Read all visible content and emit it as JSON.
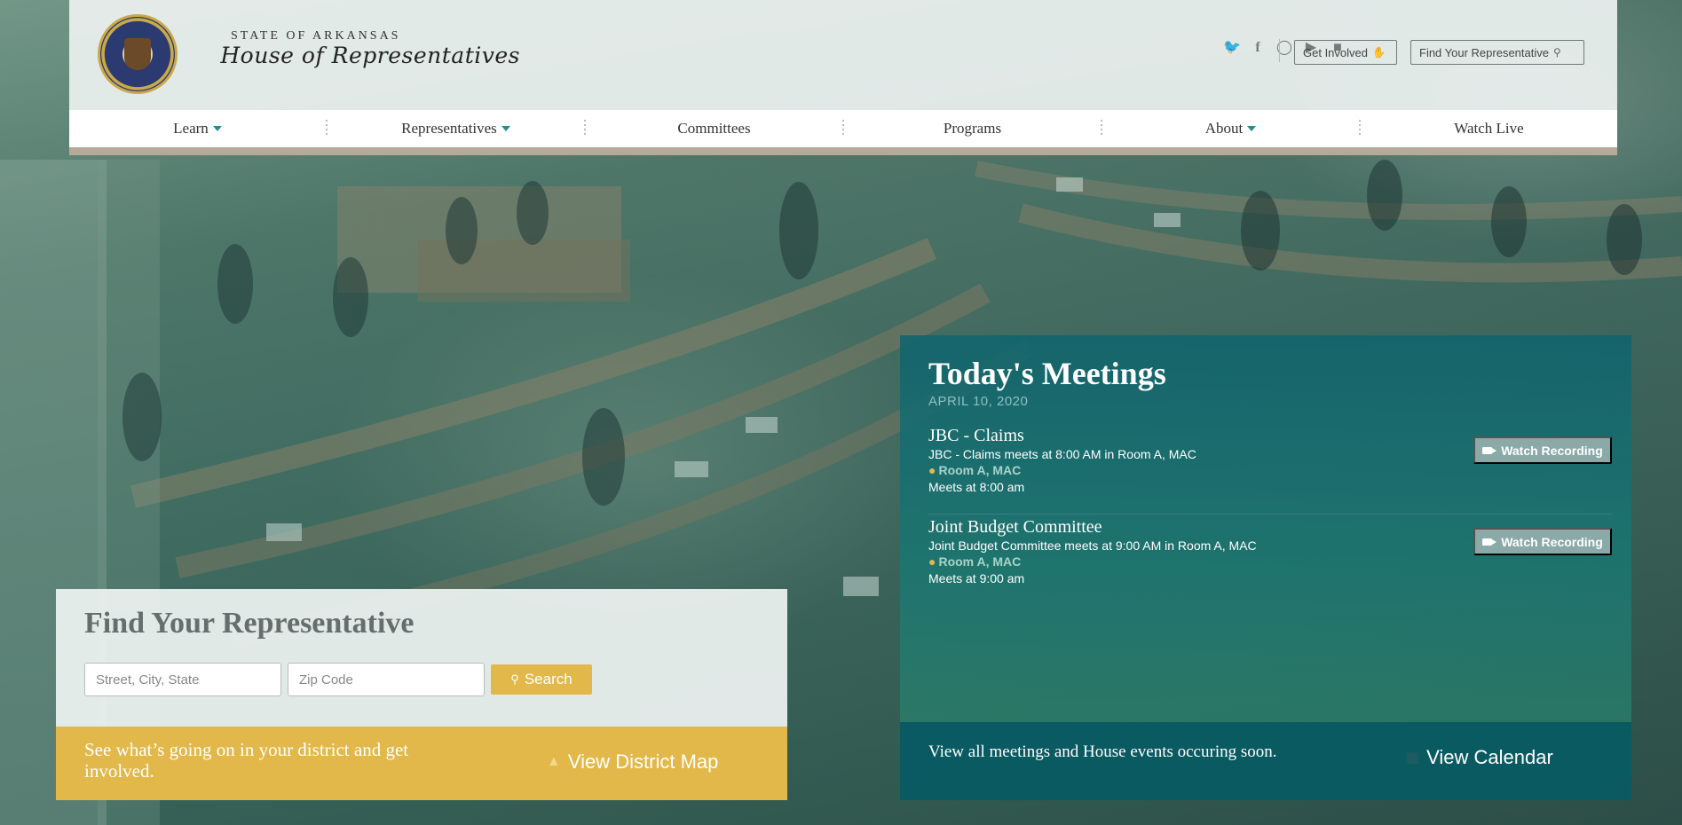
{
  "header": {
    "brand_top": "STATE OF ARKANSAS",
    "brand_main": "House of Representatives",
    "social_icons": [
      "twitter-icon",
      "facebook-icon",
      "instagram-icon",
      "youtube-icon",
      "video-icon"
    ],
    "get_involved_label": "Get Involved",
    "find_rep_label": "Find Your Representative"
  },
  "nav": {
    "items": [
      {
        "label": "Learn",
        "dropdown": true
      },
      {
        "label": "Representatives",
        "dropdown": true
      },
      {
        "label": "Committees",
        "dropdown": false
      },
      {
        "label": "Programs",
        "dropdown": false
      },
      {
        "label": "About",
        "dropdown": true
      },
      {
        "label": "Watch Live",
        "dropdown": false
      }
    ]
  },
  "meetings": {
    "title": "Today's Meetings",
    "date": "APRIL 10, 2020",
    "items": [
      {
        "name": "JBC - Claims",
        "description": "JBC - Claims meets at 8:00 AM in Room A, MAC",
        "room": "Room A, MAC",
        "time": "Meets at 8:00 am",
        "button": "Watch Recording"
      },
      {
        "name": "Joint Budget Committee",
        "description": "Joint Budget Committee meets at 9:00 AM in Room A, MAC",
        "room": "Room A, MAC",
        "time": "Meets at 9:00 am",
        "button": "Watch Recording"
      }
    ],
    "calendar_text": "View all meetings and House events occuring soon.",
    "calendar_link": "View Calendar"
  },
  "find_rep": {
    "title": "Find Your Representative",
    "street_placeholder": "Street, City, State",
    "zip_placeholder": "Zip Code",
    "search_label": "Search",
    "district_text": "See what’s going on in your district and get involved.",
    "district_link": "View District Map"
  },
  "colors": {
    "accent_teal": "#0f646e",
    "gold": "#e2b84a",
    "nav_border": "#b6a99a"
  }
}
